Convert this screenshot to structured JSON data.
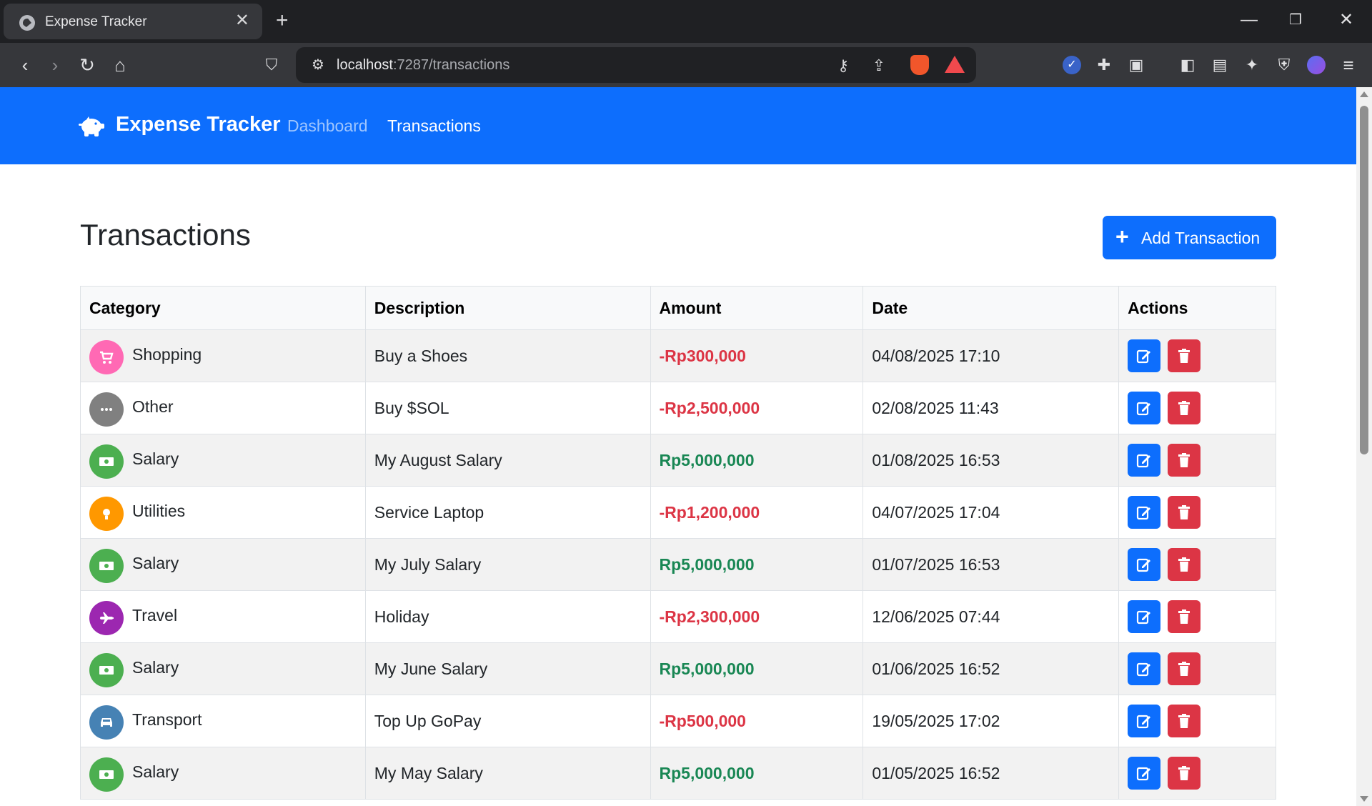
{
  "browser": {
    "tab_title": "Expense Tracker",
    "url_host": "localhost",
    "url_path": ":7287/transactions"
  },
  "navbar": {
    "brand": "Expense Tracker",
    "links": [
      {
        "label": "Dashboard",
        "active": false
      },
      {
        "label": "Transactions",
        "active": true
      }
    ]
  },
  "page": {
    "title": "Transactions",
    "add_button": "Add Transaction"
  },
  "table": {
    "headers": [
      "Category",
      "Description",
      "Amount",
      "Date",
      "Actions"
    ],
    "rows": [
      {
        "category": "Shopping",
        "icon": "cart-icon",
        "color": "#ff69b4",
        "description": "Buy a Shoes",
        "amount": "-Rp300,000",
        "type": "expense",
        "date": "04/08/2025 17:10"
      },
      {
        "category": "Other",
        "icon": "ellipsis-icon",
        "color": "#808080",
        "description": "Buy $SOL",
        "amount": "-Rp2,500,000",
        "type": "expense",
        "date": "02/08/2025 11:43"
      },
      {
        "category": "Salary",
        "icon": "money-icon",
        "color": "#4caf50",
        "description": "My August Salary",
        "amount": "Rp5,000,000",
        "type": "income",
        "date": "01/08/2025 16:53"
      },
      {
        "category": "Utilities",
        "icon": "lightbulb-icon",
        "color": "#ff9800",
        "description": "Service Laptop",
        "amount": "-Rp1,200,000",
        "type": "expense",
        "date": "04/07/2025 17:04"
      },
      {
        "category": "Salary",
        "icon": "money-icon",
        "color": "#4caf50",
        "description": "My July Salary",
        "amount": "Rp5,000,000",
        "type": "income",
        "date": "01/07/2025 16:53"
      },
      {
        "category": "Travel",
        "icon": "plane-icon",
        "color": "#9c27b0",
        "description": "Holiday",
        "amount": "-Rp2,300,000",
        "type": "expense",
        "date": "12/06/2025 07:44"
      },
      {
        "category": "Salary",
        "icon": "money-icon",
        "color": "#4caf50",
        "description": "My June Salary",
        "amount": "Rp5,000,000",
        "type": "income",
        "date": "01/06/2025 16:52"
      },
      {
        "category": "Transport",
        "icon": "car-icon",
        "color": "#4682b4",
        "description": "Top Up GoPay",
        "amount": "-Rp500,000",
        "type": "expense",
        "date": "19/05/2025 17:02"
      },
      {
        "category": "Salary",
        "icon": "money-icon",
        "color": "#4caf50",
        "description": "My May Salary",
        "amount": "Rp5,000,000",
        "type": "income",
        "date": "01/05/2025 16:52"
      }
    ]
  },
  "colors": {
    "primary": "#0d6efd",
    "danger": "#dc3545",
    "success": "#198754"
  }
}
